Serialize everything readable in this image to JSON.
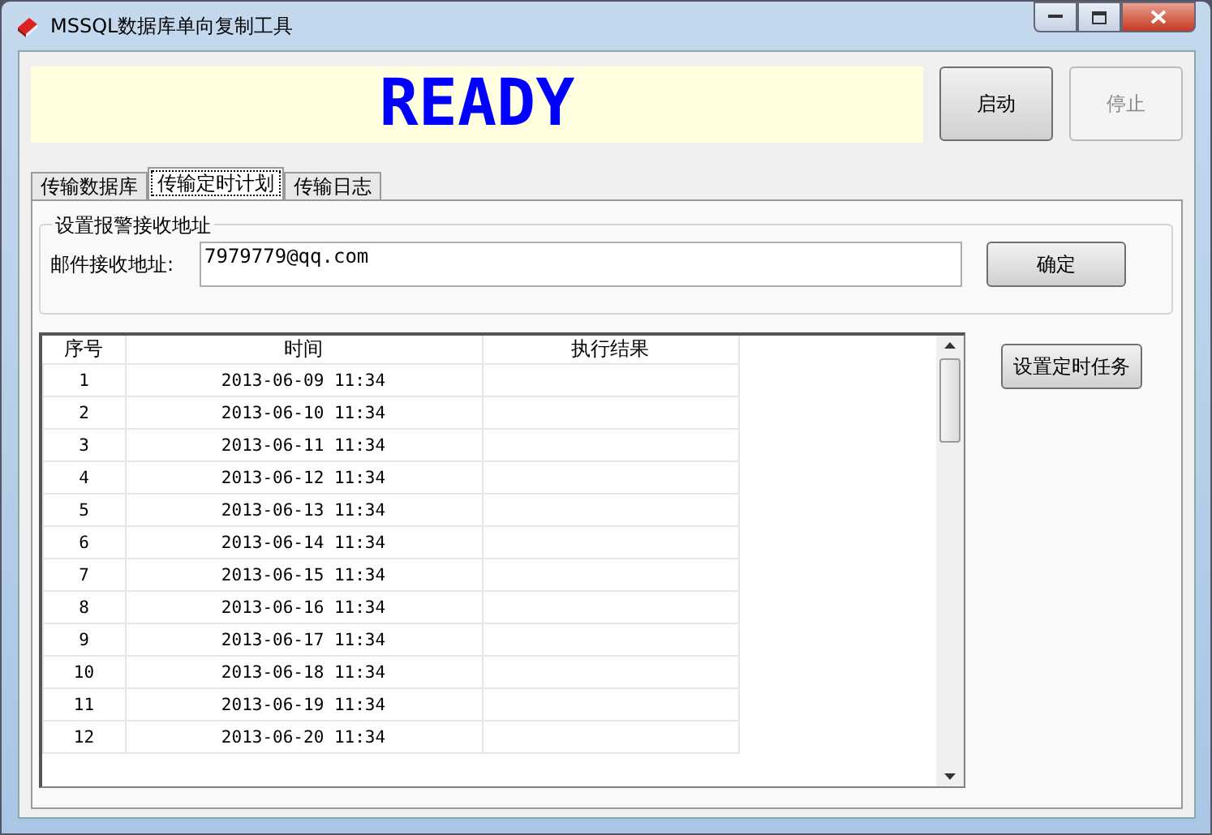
{
  "window": {
    "title": "MSSQL数据库单向复制工具"
  },
  "status": {
    "text": "READY"
  },
  "buttons": [
    {
      "label": "启动",
      "disabled": false
    },
    {
      "label": "停止",
      "disabled": true
    }
  ],
  "tabs": [
    {
      "label": "传输数据库",
      "selected": false
    },
    {
      "label": "传输定时计划",
      "selected": true
    },
    {
      "label": "传输日志",
      "selected": false
    }
  ],
  "alert_group": {
    "title": "设置报警接收地址",
    "field_label": "邮件接收地址:",
    "value": "7979779@qq.com",
    "confirm_button": "确定"
  },
  "table": {
    "columns": [
      "序号",
      "时间",
      "执行结果"
    ],
    "rows": [
      [
        "1",
        "2013-06-09 11:34",
        ""
      ],
      [
        "2",
        "2013-06-10 11:34",
        ""
      ],
      [
        "3",
        "2013-06-11 11:34",
        ""
      ],
      [
        "4",
        "2013-06-12 11:34",
        ""
      ],
      [
        "5",
        "2013-06-13 11:34",
        ""
      ],
      [
        "6",
        "2013-06-14 11:34",
        ""
      ],
      [
        "7",
        "2013-06-15 11:34",
        ""
      ],
      [
        "8",
        "2013-06-16 11:34",
        ""
      ],
      [
        "9",
        "2013-06-17 11:34",
        ""
      ],
      [
        "10",
        "2013-06-18 11:34",
        ""
      ],
      [
        "11",
        "2013-06-19 11:34",
        ""
      ],
      [
        "12",
        "2013-06-20 11:34",
        ""
      ]
    ]
  },
  "schedule_button": "设置定时任务"
}
